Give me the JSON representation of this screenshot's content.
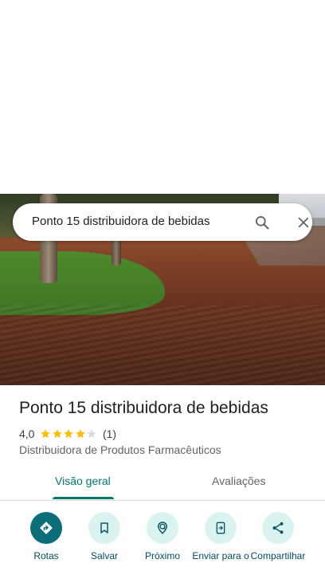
{
  "search": {
    "query": "Ponto 15 distribuidora de bebidas",
    "search_icon": "search-icon",
    "close_icon": "close-icon"
  },
  "place": {
    "title": "Ponto 15 distribuidora de bebidas",
    "rating": "4,0",
    "rating_value": 4.0,
    "rating_max": 5,
    "review_count": "(1)",
    "category": "Distribuidora de Produtos Farmacêuticos"
  },
  "tabs": [
    {
      "label": "Visão geral",
      "selected": true
    },
    {
      "label": "Avaliações",
      "selected": false
    }
  ],
  "actions": [
    {
      "label": "Rotas",
      "icon": "directions-icon"
    },
    {
      "label": "Salvar",
      "icon": "bookmark-icon"
    },
    {
      "label": "Próximo",
      "icon": "nearby-icon"
    },
    {
      "label": "Enviar para o",
      "icon": "send-to-phone-icon"
    },
    {
      "label": "Compartilhar",
      "icon": "share-icon"
    }
  ],
  "colors": {
    "accent": "#00796b",
    "primary_action": "#0b6e78",
    "action_tint": "#d9f3f1",
    "star": "#fbbc04"
  }
}
